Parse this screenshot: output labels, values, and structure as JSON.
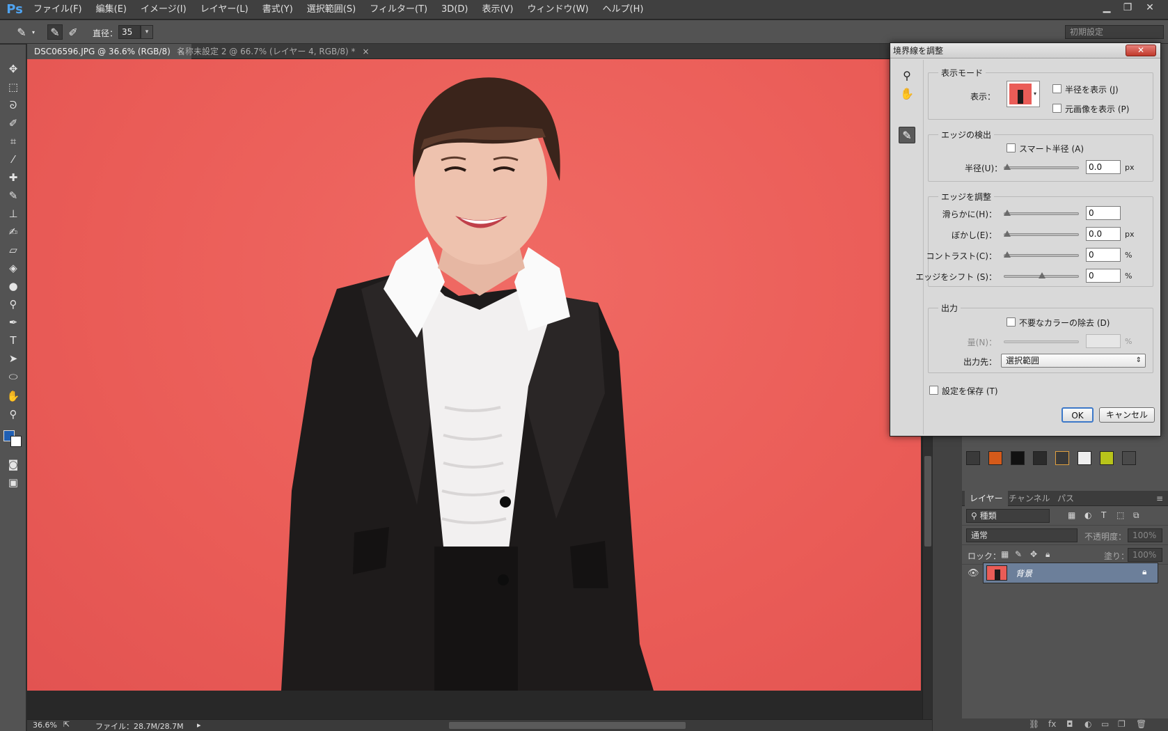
{
  "app": {
    "logo": "Ps"
  },
  "menu": [
    "ファイル(F)",
    "編集(E)",
    "イメージ(I)",
    "レイヤー(L)",
    "書式(Y)",
    "選択範囲(S)",
    "フィルター(T)",
    "3D(D)",
    "表示(V)",
    "ウィンドウ(W)",
    "ヘルプ(H)"
  ],
  "options_bar": {
    "diameter_label": "直径：",
    "diameter_value": "35",
    "workspace": "初期設定"
  },
  "tabs": [
    {
      "label": "DSC06596.JPG @ 36.6% (RGB/8)",
      "close": "×"
    },
    {
      "label": "名称未設定 2 @ 66.7% (レイヤー 4, RGB/8) *",
      "close": "×"
    }
  ],
  "status": {
    "zoom": "36.6%",
    "file": "ファイル：28.7M/28.7M"
  },
  "layers_panel": {
    "tabs": [
      "レイヤー",
      "チャンネル",
      "パス"
    ],
    "kind": "種類",
    "blend_mode": "通常",
    "opacity_label": "不透明度：",
    "opacity_value": "100%",
    "lock_label": "ロック：",
    "fill_label": "塗り：",
    "fill_value": "100%",
    "layer_name": "背景"
  },
  "dialog": {
    "title": "境界線を調整",
    "close": "✕",
    "view_mode": {
      "title": "表示モード",
      "view_label": "表示：",
      "show_radius": "半径を表示 (J)",
      "show_original": "元画像を表示 (P)"
    },
    "edge_detection": {
      "title": "エッジの検出",
      "smart_radius": "スマート半径 (A)",
      "radius_label": "半径(U)：",
      "radius_value": "0.0",
      "radius_unit": "px"
    },
    "adjust_edge": {
      "title": "エッジを調整",
      "smooth_label": "滑らかに(H)：",
      "smooth_value": "0",
      "feather_label": "ぼかし(E)：",
      "feather_value": "0.0",
      "feather_unit": "px",
      "contrast_label": "コントラスト(C)：",
      "contrast_value": "0",
      "contrast_unit": "%",
      "shift_label": "エッジをシフト (S)：",
      "shift_value": "0",
      "shift_unit": "%"
    },
    "output": {
      "title": "出力",
      "decontaminate": "不要なカラーの除去 (D)",
      "amount_label": "量(N)：",
      "amount_unit": "%",
      "output_to_label": "出力先：",
      "output_to_value": "選択範囲"
    },
    "remember": "設定を保存 (T)",
    "ok": "OK",
    "cancel": "キャンセル"
  },
  "colors": {
    "canvas_bg": "#ea5c57",
    "foreground": "#1f5fb4",
    "background": "#ffffff",
    "accent": "#3c78c8"
  }
}
